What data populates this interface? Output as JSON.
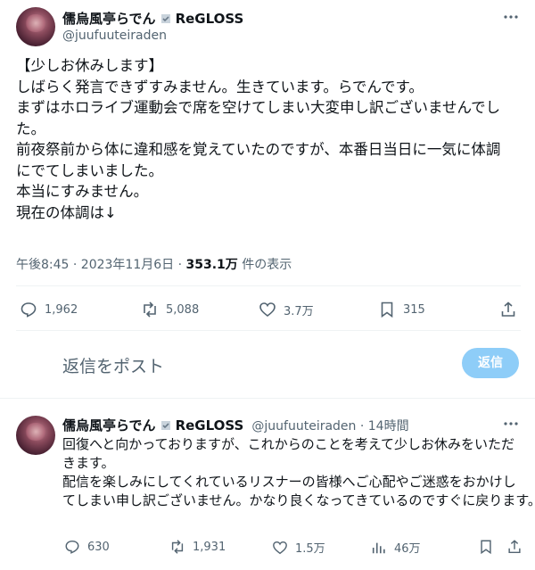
{
  "main_post": {
    "author_name": "儒烏風亭らでん",
    "group": "ReGLOSS",
    "handle": "@juufuuteiraden",
    "more_icon": "more-icon",
    "lines": [
      "【少しお休みします】",
      "しばらく発言できずすみません。生きています。らでんです。",
      "まずはホロライブ運動会で席を空けてしまい大変申し訳ございませんでし",
      "た。",
      "前夜祭前から体に違和感を覚えていたのですが、本番日当日に一気に体調",
      "にでてしまいました。",
      "本当にすみません。",
      "現在の体調は↓"
    ],
    "timestamp": "午後8:45 · 2023年11月6日 · ",
    "views": "353.1万",
    "views_suffix": " 件の表示",
    "replies": "1,962",
    "reposts": "5,088",
    "likes": "3.7万",
    "bookmarks": "315"
  },
  "reply_box": {
    "placeholder": "返信をポスト",
    "button": "返信"
  },
  "reply_post": {
    "author_name": "儒烏風亭らでん",
    "group": "ReGLOSS",
    "handle": "@juufuuteiraden · 14時間",
    "lines": [
      "回復へと向かっておりますが、これからのことを考えて少しお休みをいただ",
      "きます。",
      "配信を楽しみにしてくれているリスナーの皆様へご心配やご迷惑をおかけし",
      "てしまい申し訳ございません。かなり良くなってきているのですぐに戻ります。"
    ],
    "replies": "630",
    "reposts": "1,931",
    "likes": "1.5万",
    "views": "46万"
  },
  "colors": {
    "text": "#0f1419",
    "muted": "#536471",
    "accent": "#1d9bf0",
    "button_disabled": "#8ecdf8"
  }
}
